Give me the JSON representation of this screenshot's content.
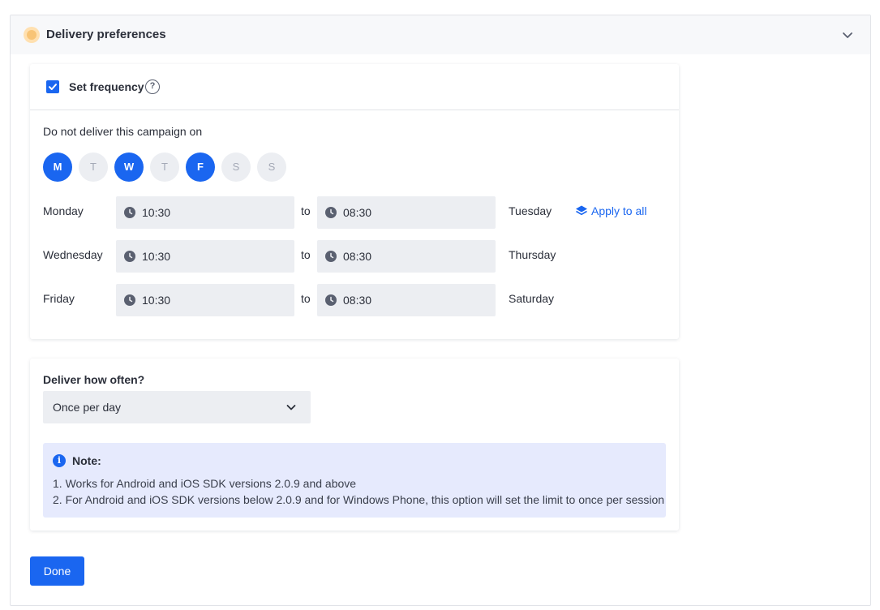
{
  "panel": {
    "title": "Delivery preferences",
    "status_color": "#f8c476"
  },
  "frequency": {
    "checkbox_checked": true,
    "label": "Set frequency",
    "help_icon": "?"
  },
  "exclusion": {
    "heading": "Do not deliver this campaign on",
    "days": [
      {
        "letter": "M",
        "selected": true
      },
      {
        "letter": "T",
        "selected": false
      },
      {
        "letter": "W",
        "selected": true
      },
      {
        "letter": "T",
        "selected": false
      },
      {
        "letter": "F",
        "selected": true
      },
      {
        "letter": "S",
        "selected": false
      },
      {
        "letter": "S",
        "selected": false
      }
    ],
    "to_label": "to",
    "apply_all_label": "Apply to all",
    "rows": [
      {
        "day": "Monday",
        "from": "10:30",
        "to": "08:30",
        "next_day": "Tuesday"
      },
      {
        "day": "Wednesday",
        "from": "10:30",
        "to": "08:30",
        "next_day": "Thursday"
      },
      {
        "day": "Friday",
        "from": "10:30",
        "to": "08:30",
        "next_day": "Saturday"
      }
    ]
  },
  "often": {
    "label": "Deliver how often?",
    "selected": "Once per day"
  },
  "note": {
    "title": "Note:",
    "info_icon": "i",
    "lines": [
      "1. Works for Android and iOS SDK versions 2.0.9 and above",
      "2. For Android and iOS SDK versions below 2.0.9 and for Windows Phone, this option will set the limit to once per session"
    ]
  },
  "actions": {
    "done_label": "Done"
  },
  "colors": {
    "accent": "#1a66f0",
    "field_bg": "#eceef2",
    "note_bg": "#e6eafd"
  }
}
